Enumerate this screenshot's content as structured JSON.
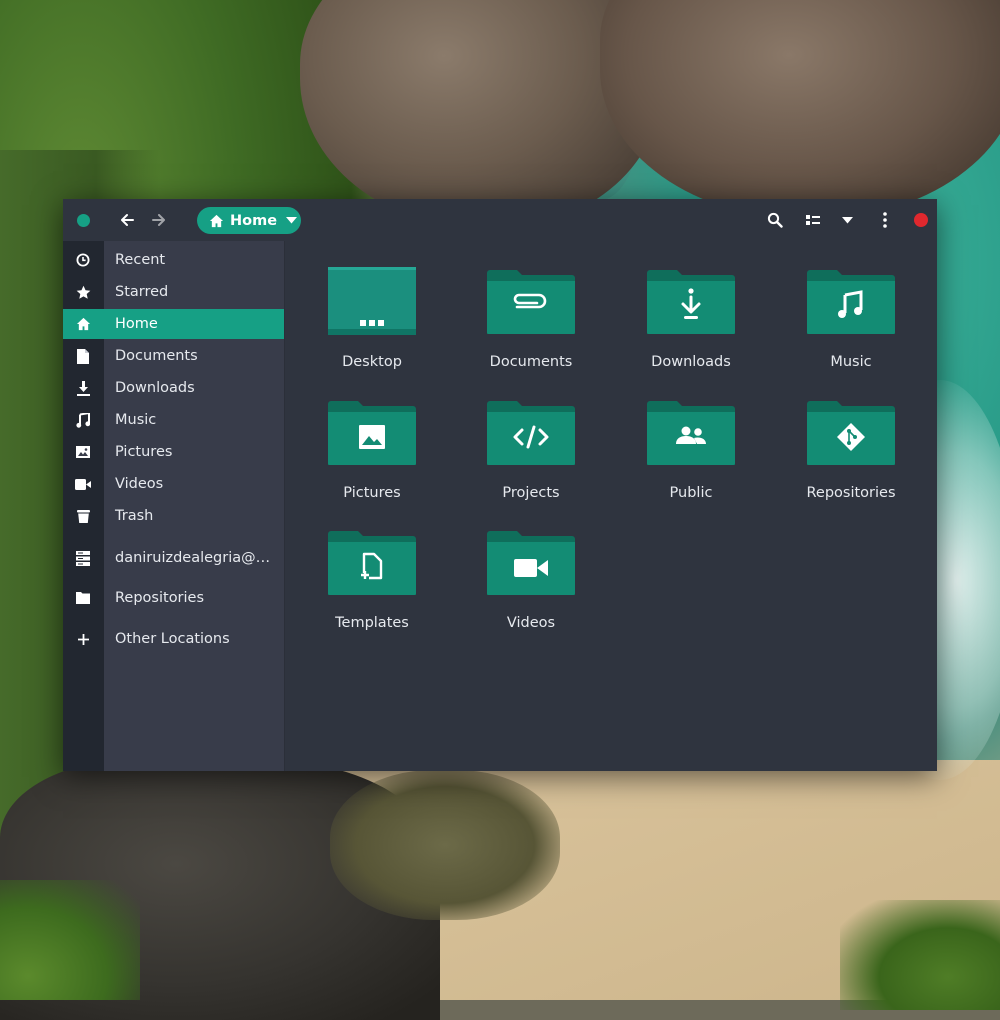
{
  "window": {
    "path_label": "Home"
  },
  "sidebar": {
    "items": [
      {
        "label": "Recent",
        "icon": "clock-icon"
      },
      {
        "label": "Starred",
        "icon": "star-icon"
      },
      {
        "label": "Home",
        "icon": "home-icon",
        "active": true
      },
      {
        "label": "Documents",
        "icon": "document-icon"
      },
      {
        "label": "Downloads",
        "icon": "download-icon"
      },
      {
        "label": "Music",
        "icon": "music-icon"
      },
      {
        "label": "Pictures",
        "icon": "image-icon"
      },
      {
        "label": "Videos",
        "icon": "video-camera-icon"
      },
      {
        "label": "Trash",
        "icon": "trash-icon"
      },
      {
        "label": "daniruizdealegria@…",
        "icon": "server-icon"
      },
      {
        "label": "Repositories",
        "icon": "folder-icon"
      },
      {
        "label": "Other Locations",
        "icon": "plus-icon"
      }
    ]
  },
  "folders": [
    {
      "name": "Desktop",
      "icon": "desktop-folder-icon"
    },
    {
      "name": "Documents",
      "icon": "paperclip-folder-icon"
    },
    {
      "name": "Downloads",
      "icon": "download-folder-icon"
    },
    {
      "name": "Music",
      "icon": "music-folder-icon"
    },
    {
      "name": "Pictures",
      "icon": "image-folder-icon"
    },
    {
      "name": "Projects",
      "icon": "code-folder-icon"
    },
    {
      "name": "Public",
      "icon": "people-folder-icon"
    },
    {
      "name": "Repositories",
      "icon": "git-folder-icon"
    },
    {
      "name": "Templates",
      "icon": "template-folder-icon"
    },
    {
      "name": "Videos",
      "icon": "video-folder-icon"
    }
  ],
  "colors": {
    "accent": "#16a085",
    "folder_front": "#138c74",
    "folder_back": "#0f6e5b",
    "window_bg": "#2f343f",
    "sidebar_bg": "#383c4a",
    "close_button": "#e0282e"
  }
}
